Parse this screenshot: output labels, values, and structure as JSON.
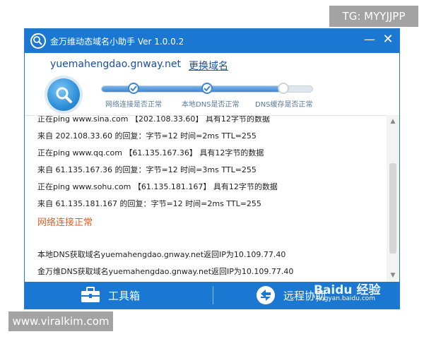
{
  "watermark_top": "TG: MYYJJPP",
  "watermark_bottom": "www.viralkim.com",
  "window": {
    "title": "金万维动态域名小助手 Ver 1.0.0.2",
    "minimize_label": "—",
    "close_label": "✕"
  },
  "domain": "yuemahengdao.gnway.net",
  "change_domain_label": "更换域名",
  "progress": {
    "fraction": 0.85,
    "steps": [
      {
        "label": "网络连接是否正常",
        "done": true
      },
      {
        "label": "本地DNS是否正常",
        "done": true
      },
      {
        "label": "DNS缓存是否正常",
        "done": false
      }
    ]
  },
  "log": {
    "lines": [
      "正在ping www.sina.com 【202.108.33.60】 具有12字节的数据",
      "来自 202.108.33.60 的回复：字节=12 时间=2ms TTL=255",
      "正在ping www.qq.com 【61.135.167.36】 具有12字节的数据",
      "来自 61.135.167.36 的回复：字节=12 时间=3ms TTL=255",
      "正在ping www.sohu.com 【61.135.181.167】 具有12字节的数据",
      "来自 61.135.181.167 的回复：字节=12 时间=2ms TTL=255"
    ],
    "status": "网络连接正常",
    "dns_lines": [
      "本地DNS获取域名yuemahengdao.gnway.net返回IP为10.109.77.40",
      "金万维DNS获取域名yuemahengdao.gnway.net返回IP为10.109.77.40"
    ]
  },
  "footer": {
    "toolbox_label": "工具箱",
    "remote_label": "远程协助"
  },
  "baidu": {
    "mark": "Baidu 经验",
    "sub": "jingyan.baidu.com"
  },
  "colors": {
    "titlebar": "#1a78d2",
    "accent": "#3d86d3",
    "status_ok": "#d9602a"
  }
}
